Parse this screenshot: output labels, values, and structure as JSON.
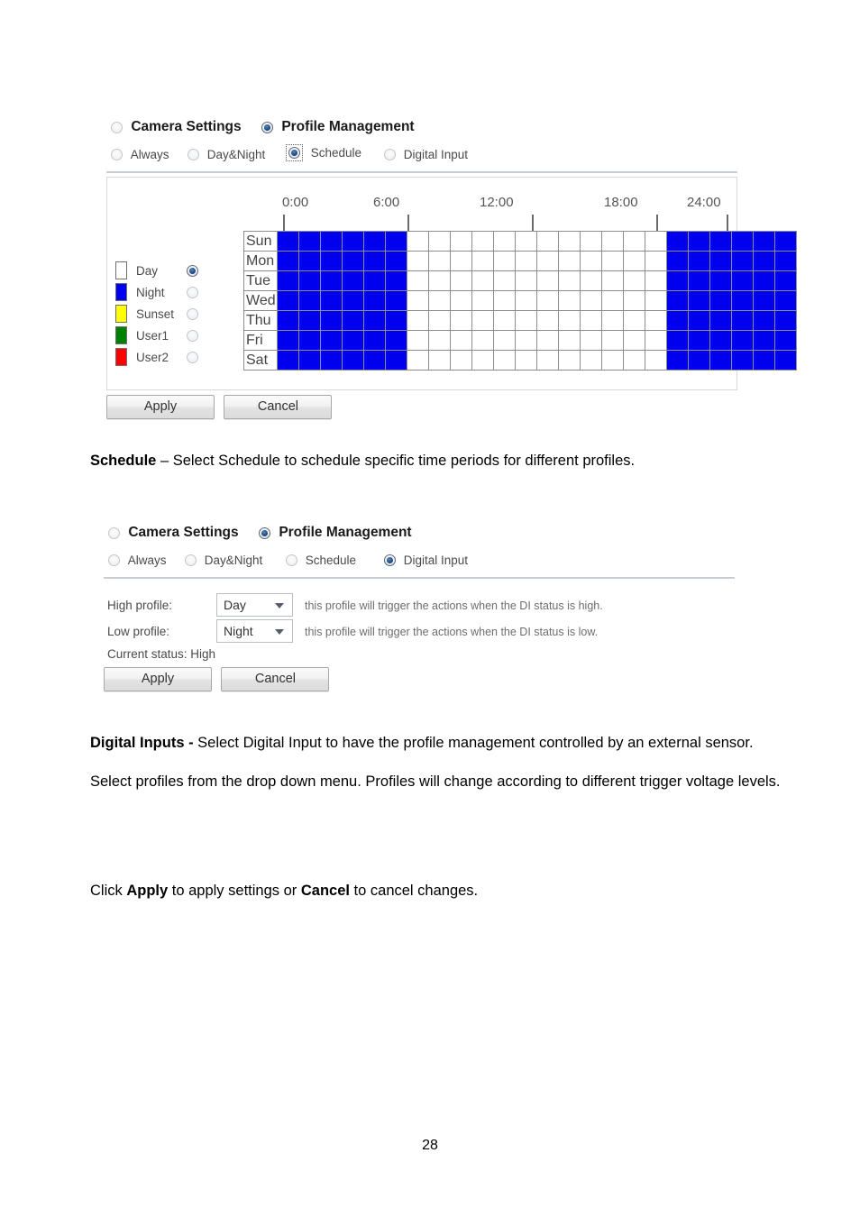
{
  "document": {
    "page_number": "28"
  },
  "panel_schedule": {
    "main_options": [
      {
        "label": "Camera Settings",
        "selected": false
      },
      {
        "label": "Profile Management",
        "selected": true
      }
    ],
    "mode_options": [
      {
        "label": "Always",
        "selected": false,
        "focused": false
      },
      {
        "label": "Day&Night",
        "selected": false,
        "focused": false
      },
      {
        "label": "Schedule",
        "selected": true,
        "focused": true
      },
      {
        "label": "Digital Input",
        "selected": false,
        "focused": false
      }
    ],
    "time_axis": {
      "ticks": [
        "0:00",
        "6:00",
        "12:00",
        "18:00",
        "24:00"
      ],
      "hours_total": 24
    },
    "days": [
      "Sun",
      "Mon",
      "Tue",
      "Wed",
      "Thu",
      "Fri",
      "Sat"
    ],
    "legend": [
      {
        "label": "Day",
        "color": "#ffffff",
        "selected": true
      },
      {
        "label": "Night",
        "color": "#0000EE",
        "selected": false
      },
      {
        "label": "Sunset",
        "color": "#FFFF00",
        "selected": false
      },
      {
        "label": "User1",
        "color": "#008000",
        "selected": false
      },
      {
        "label": "User2",
        "color": "#FF0000",
        "selected": false
      }
    ],
    "buttons": {
      "apply": "Apply",
      "cancel": "Cancel"
    }
  },
  "schedule_grid": {
    "legend_profile_for_filled_cells": "Night",
    "filled_color": "#0000EE",
    "empty_color": "#ffffff",
    "hour_columns": 24,
    "rows": [
      {
        "day": "Sun",
        "hours": [
          1,
          1,
          1,
          1,
          1,
          1,
          0,
          0,
          0,
          0,
          0,
          0,
          0,
          0,
          0,
          0,
          0,
          0,
          1,
          1,
          1,
          1,
          1,
          1
        ]
      },
      {
        "day": "Mon",
        "hours": [
          1,
          1,
          1,
          1,
          1,
          1,
          0,
          0,
          0,
          0,
          0,
          0,
          0,
          0,
          0,
          0,
          0,
          0,
          1,
          1,
          1,
          1,
          1,
          1
        ]
      },
      {
        "day": "Tue",
        "hours": [
          1,
          1,
          1,
          1,
          1,
          1,
          0,
          0,
          0,
          0,
          0,
          0,
          0,
          0,
          0,
          0,
          0,
          0,
          1,
          1,
          1,
          1,
          1,
          1
        ]
      },
      {
        "day": "Wed",
        "hours": [
          1,
          1,
          1,
          1,
          1,
          1,
          0,
          0,
          0,
          0,
          0,
          0,
          0,
          0,
          0,
          0,
          0,
          0,
          1,
          1,
          1,
          1,
          1,
          1
        ]
      },
      {
        "day": "Thu",
        "hours": [
          1,
          1,
          1,
          1,
          1,
          1,
          0,
          0,
          0,
          0,
          0,
          0,
          0,
          0,
          0,
          0,
          0,
          0,
          1,
          1,
          1,
          1,
          1,
          1
        ]
      },
      {
        "day": "Fri",
        "hours": [
          1,
          1,
          1,
          1,
          1,
          1,
          0,
          0,
          0,
          0,
          0,
          0,
          0,
          0,
          0,
          0,
          0,
          0,
          1,
          1,
          1,
          1,
          1,
          1
        ]
      },
      {
        "day": "Sat",
        "hours": [
          1,
          1,
          1,
          1,
          1,
          1,
          0,
          0,
          0,
          0,
          0,
          0,
          0,
          0,
          0,
          0,
          0,
          0,
          1,
          1,
          1,
          1,
          1,
          1
        ]
      }
    ]
  },
  "caption_schedule": {
    "term": "Schedule",
    "rest": " – Select Schedule to schedule specific time periods for different profiles."
  },
  "panel_digital_input": {
    "main_options": [
      {
        "label": "Camera Settings",
        "selected": false
      },
      {
        "label": "Profile Management",
        "selected": true
      }
    ],
    "mode_options": [
      {
        "label": "Always",
        "selected": false
      },
      {
        "label": "Day&Night",
        "selected": false
      },
      {
        "label": "Schedule",
        "selected": false
      },
      {
        "label": "Digital Input",
        "selected": true
      }
    ],
    "high_profile": {
      "label": "High profile:",
      "value": "Day",
      "hint": "this profile will trigger the actions when the DI status is high."
    },
    "low_profile": {
      "label": "Low profile:",
      "value": "Night",
      "hint": "this profile will trigger the actions when the DI status is low."
    },
    "current_status": "Current status: High",
    "buttons": {
      "apply": "Apply",
      "cancel": "Cancel"
    }
  },
  "caption_digital_inputs": {
    "term": "Digital Inputs -",
    "rest": " Select Digital Input to have the profile management controlled by an external sensor. Select profiles from the drop down menu. Profiles will change according to different trigger voltage levels."
  },
  "caption_apply": {
    "p1": "Click ",
    "b1": "Apply",
    "p2": " to apply settings or ",
    "b2": "Cancel",
    "p3": " to cancel changes."
  }
}
